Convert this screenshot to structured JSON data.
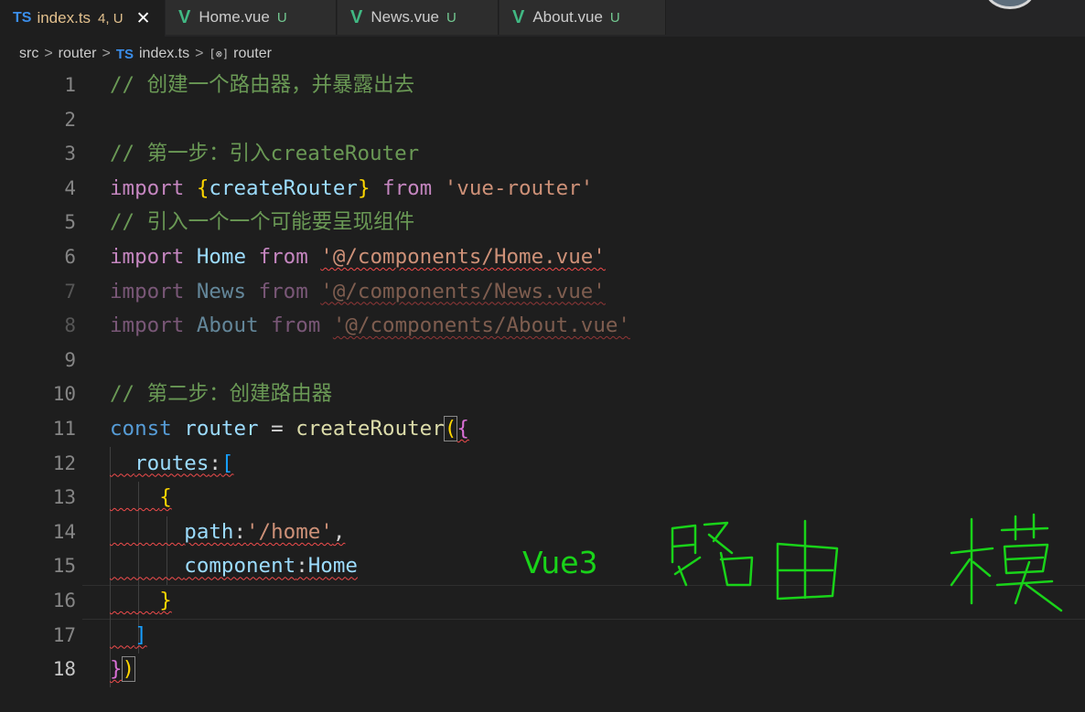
{
  "tabs": [
    {
      "icon": "TS",
      "name": "index.ts",
      "status": "4, U",
      "close": "✕",
      "active": true
    },
    {
      "icon": "V",
      "name": "Home.vue",
      "status": "U",
      "active": false
    },
    {
      "icon": "V",
      "name": "News.vue",
      "status": "U",
      "active": false
    },
    {
      "icon": "V",
      "name": "About.vue",
      "status": "U",
      "active": false
    }
  ],
  "breadcrumb": {
    "src": "src",
    "router_folder": "router",
    "file_icon": "TS",
    "file": "index.ts",
    "symbol_icon": "[⊗]",
    "symbol": "router",
    "separator": ">"
  },
  "code": {
    "line_numbers": [
      "1",
      "2",
      "3",
      "4",
      "5",
      "6",
      "7",
      "8",
      "9",
      "10",
      "11",
      "12",
      "13",
      "14",
      "15",
      "16",
      "17",
      "18"
    ],
    "l1_comment": "// 创建一个路由器，并暴露出去",
    "l3_comment": "// 第一步：引入createRouter",
    "l4_import": "import",
    "l4_brace_open": "{",
    "l4_name": "createRouter",
    "l4_brace_close": "}",
    "l4_from": "from",
    "l4_str": "'vue-router'",
    "l5_comment": "// 引入一个一个可能要呈现组件",
    "l6_import": "import",
    "l6_name": "Home",
    "l6_from": "from",
    "l6_str": "'@/components/Home.vue'",
    "l7_import": "import",
    "l7_name": "News",
    "l7_from": "from",
    "l7_str": "'@/components/News.vue'",
    "l8_import": "import",
    "l8_name": "About",
    "l8_from": "from",
    "l8_str": "'@/components/About.vue'",
    "l10_comment": "// 第二步：创建路由器",
    "l11_const": "const",
    "l11_var": "router",
    "l11_eq": "=",
    "l11_fn": "createRouter",
    "l11_paren": "(",
    "l11_brace": "{",
    "l12_key": "routes",
    "l12_colon": ":",
    "l12_bracket": "[",
    "l13_brace": "{",
    "l14_key": "path",
    "l14_colon": ":",
    "l14_str": "'/home'",
    "l14_comma": ",",
    "l15_key": "component",
    "l15_colon": ":",
    "l15_val": "Home",
    "l16_brace": "}",
    "l17_bracket": "]",
    "l18_brace": "}",
    "l18_paren": ")"
  },
  "annotation": {
    "label": "Vue3",
    "color": "#19d319",
    "handwriting": "路由 模"
  },
  "colors": {
    "comment": "#6a9955",
    "keyword": "#c586c0",
    "string": "#ce9178",
    "variable": "#9cdcfe",
    "function": "#dcdcaa",
    "error_squiggle": "#f14c4c"
  },
  "icons": [
    "typescript-file-icon",
    "vue-file-icon",
    "close-icon",
    "symbol-variable-icon",
    "chevron-right-icon",
    "account-avatar-icon"
  ]
}
